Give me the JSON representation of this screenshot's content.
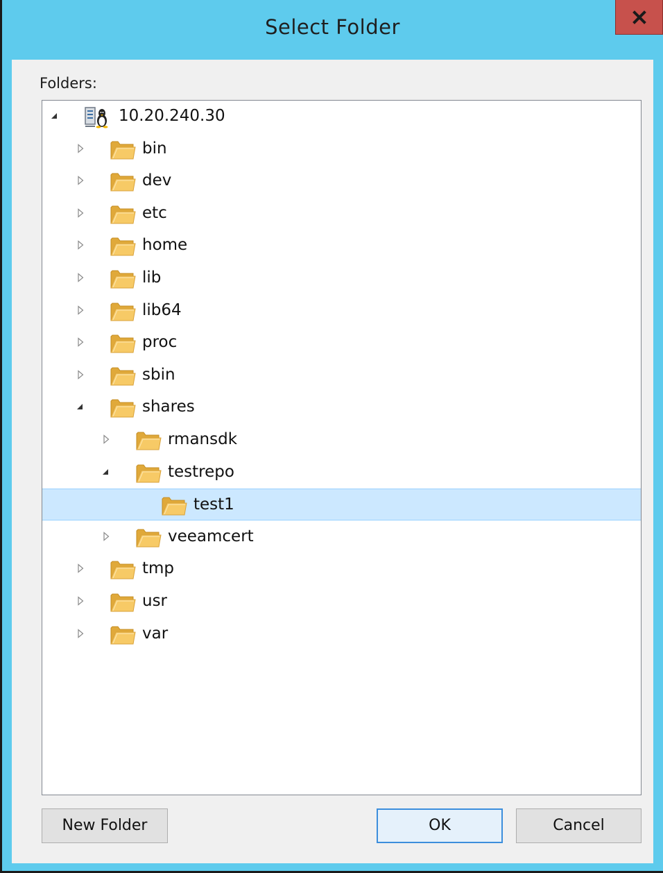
{
  "window": {
    "title": "Select Folder",
    "close_label": "x"
  },
  "tree": {
    "label": "Folders:",
    "root": "10.20.240.30",
    "items": [
      {
        "label": "bin",
        "level": 1,
        "state": "collapsed"
      },
      {
        "label": "dev",
        "level": 1,
        "state": "collapsed"
      },
      {
        "label": "etc",
        "level": 1,
        "state": "collapsed"
      },
      {
        "label": "home",
        "level": 1,
        "state": "collapsed"
      },
      {
        "label": "lib",
        "level": 1,
        "state": "collapsed"
      },
      {
        "label": "lib64",
        "level": 1,
        "state": "collapsed"
      },
      {
        "label": "proc",
        "level": 1,
        "state": "collapsed"
      },
      {
        "label": "sbin",
        "level": 1,
        "state": "collapsed"
      },
      {
        "label": "shares",
        "level": 1,
        "state": "expanded"
      },
      {
        "label": "rmansdk",
        "level": 2,
        "state": "collapsed"
      },
      {
        "label": "testrepo",
        "level": 2,
        "state": "expanded"
      },
      {
        "label": "test1",
        "level": 3,
        "state": "leaf",
        "selected": true
      },
      {
        "label": "veeamcert",
        "level": 2,
        "state": "collapsed"
      },
      {
        "label": "tmp",
        "level": 1,
        "state": "collapsed"
      },
      {
        "label": "usr",
        "level": 1,
        "state": "collapsed"
      },
      {
        "label": "var",
        "level": 1,
        "state": "collapsed"
      }
    ]
  },
  "buttons": {
    "new_folder": "New Folder",
    "ok": "OK",
    "cancel": "Cancel"
  },
  "colors": {
    "titlebar": "#5ecbed",
    "close_button": "#c7514c",
    "selection": "#cce8ff",
    "folder": "#f5c25a"
  },
  "icons": {
    "root": "linux-server-icon",
    "node": "folder-icon",
    "expand": "expand-arrow-icon",
    "collapse": "collapse-arrow-icon"
  }
}
